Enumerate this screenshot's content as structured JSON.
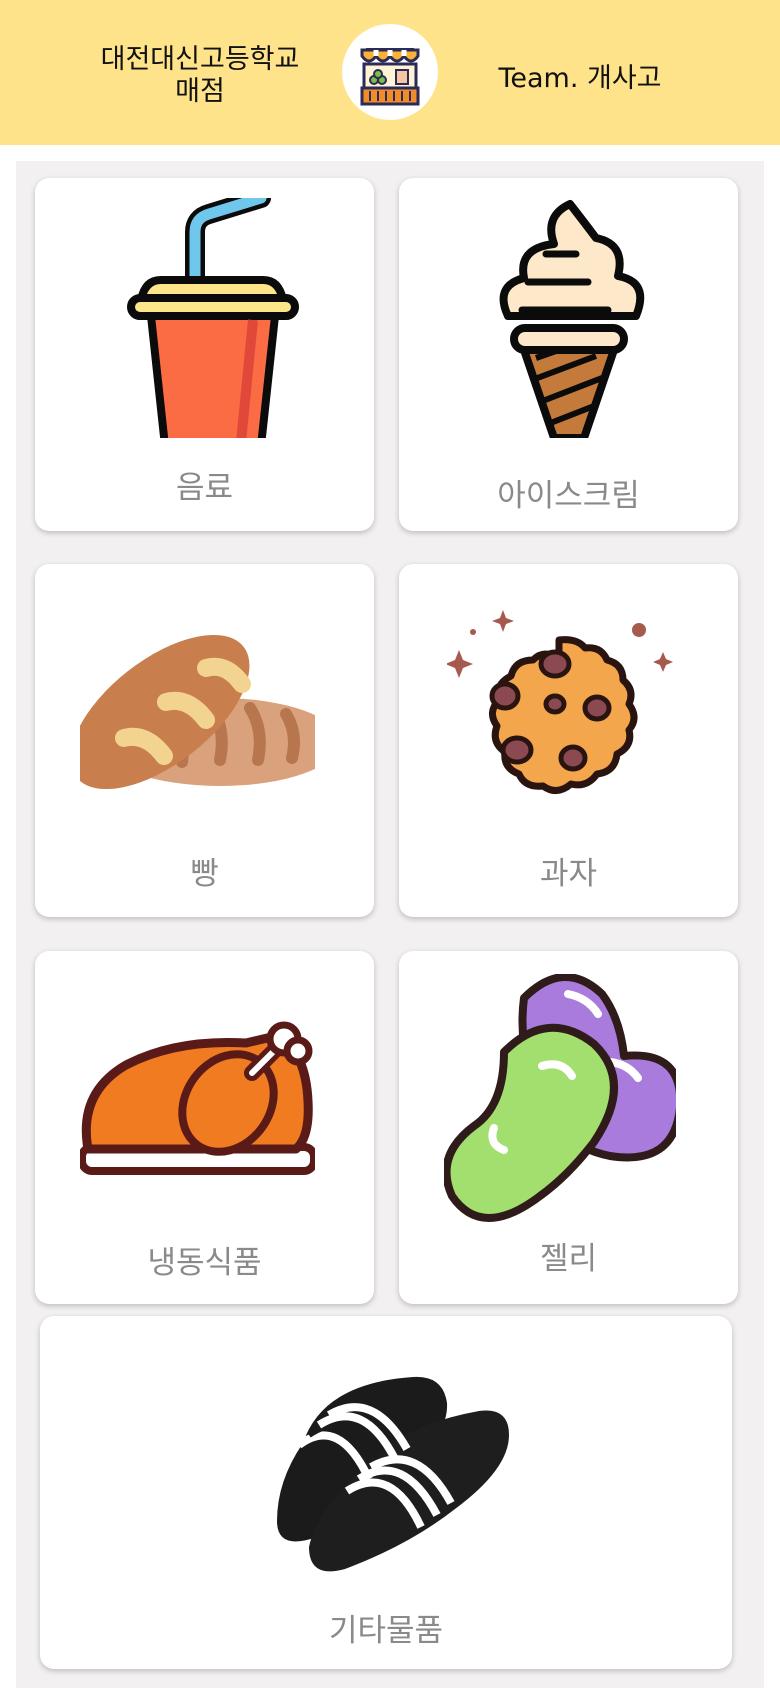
{
  "header": {
    "school_line1": "대전대신고등학교",
    "school_line2": "매점",
    "team": "Team. 개사고",
    "logo_icon": "store-stall-icon",
    "background": "#fee38a"
  },
  "categories": [
    {
      "label": "음료",
      "icon": "soft-drink-cup-icon"
    },
    {
      "label": "아이스크림",
      "icon": "ice-cream-cone-icon"
    },
    {
      "label": "빵",
      "icon": "bread-icon"
    },
    {
      "label": "과자",
      "icon": "cookie-icon"
    },
    {
      "label": "냉동식품",
      "icon": "roast-chicken-icon"
    },
    {
      "label": "젤리",
      "icon": "jelly-bean-icon"
    },
    {
      "label": "기타물품",
      "icon": "slippers-icon"
    }
  ]
}
